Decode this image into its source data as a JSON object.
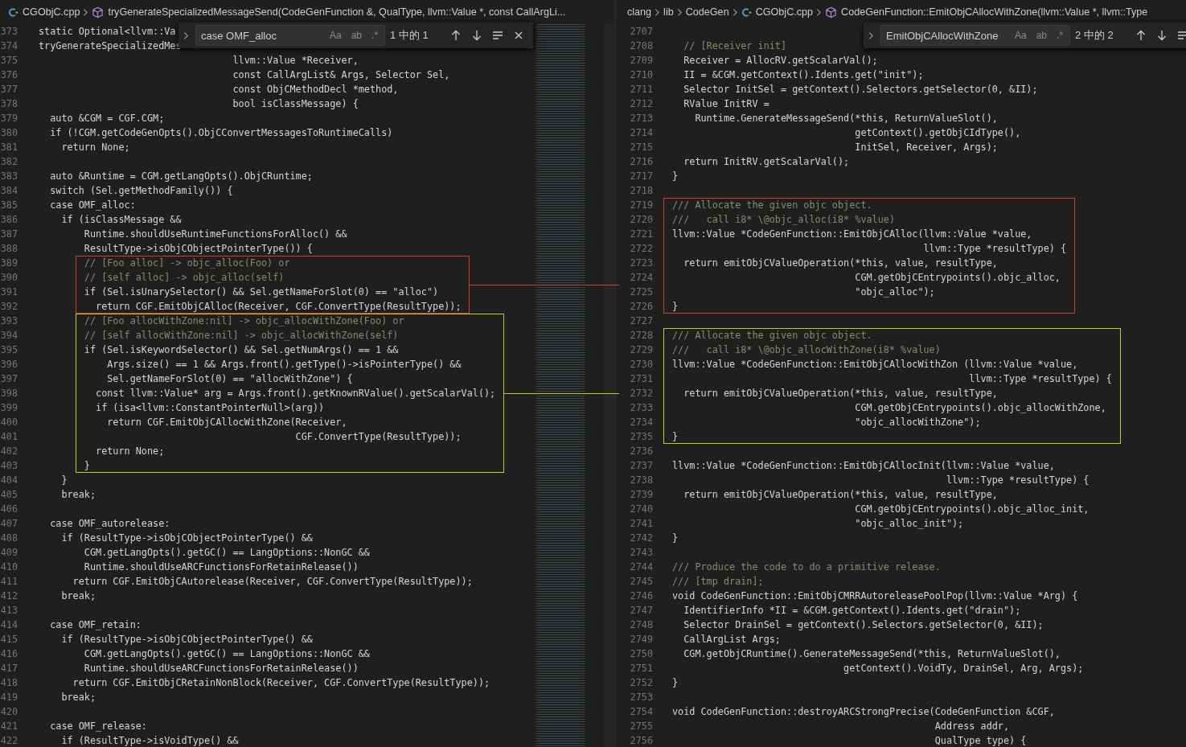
{
  "panes": [
    {
      "minimap": true,
      "breadcrumbs": [
        {
          "kind": "file",
          "text": "CGObjC.cpp"
        },
        {
          "kind": "symbol",
          "text": "tryGenerateSpecializedMessageSend(CodeGenFunction &, QualType, llvm::Value *, const CallArgLi..."
        }
      ],
      "find": {
        "value": "case OMF_alloc",
        "toggles": [
          "Aa",
          "ab",
          ".*"
        ],
        "count": "1 中的 1",
        "buttons": [
          {
            "kind": "previous"
          },
          {
            "kind": "next"
          },
          {
            "kind": "selection"
          },
          {
            "kind": "close"
          }
        ]
      },
      "blocks": [
        {
          "lines": [
            {
              "kind": "code",
              "number": "373",
              "code": "static Optional<llvm::Va"
            },
            {
              "kind": "code",
              "number": "374",
              "code": "tryGenerateSpecializedMes"
            },
            {
              "kind": "code",
              "number": "375",
              "code": "                                  llvm::Value *Receiver,"
            },
            {
              "kind": "code",
              "number": "376",
              "code": "                                  const CallArgList& Args, Selector Sel,"
            },
            {
              "kind": "code",
              "number": "377",
              "code": "                                  const ObjCMethodDecl *method,"
            },
            {
              "kind": "code",
              "number": "378",
              "code": "                                  bool isClassMessage) {"
            },
            {
              "kind": "code",
              "number": "379",
              "code": "  auto &CGM = CGF.CGM;"
            },
            {
              "kind": "code",
              "number": "380",
              "code": "  if (!CGM.getCodeGenOpts().ObjCConvertMessagesToRuntimeCalls)"
            },
            {
              "kind": "code",
              "number": "381",
              "code": "    return None;"
            },
            {
              "kind": "code",
              "number": "382"
            },
            {
              "kind": "code",
              "number": "383",
              "code": "  auto &Runtime = CGM.getLangOpts().ObjCRuntime;"
            },
            {
              "kind": "code",
              "number": "384",
              "code": "  switch (Sel.getMethodFamily()) {"
            },
            {
              "kind": "code",
              "number": "385",
              "code": "  case OMF_alloc:"
            },
            {
              "kind": "code",
              "number": "386",
              "code": "    if (isClassMessage &&"
            },
            {
              "kind": "code",
              "number": "387",
              "code": "        Runtime.shouldUseRuntimeFunctionsForAlloc() &&"
            },
            {
              "kind": "code",
              "number": "388",
              "code": "        ResultType->isObjCObjectPointerType()) {"
            }
          ]
        },
        {
          "color": "#c8402f",
          "lines": [
            {
              "kind": "comment",
              "number": "389",
              "code": "        // [Foo alloc] -> objc_alloc(Foo) or"
            },
            {
              "kind": "comment",
              "number": "390",
              "code": "        // [self alloc] -> objc_alloc(self)"
            },
            {
              "kind": "code",
              "number": "391",
              "code": "        if (Sel.isUnarySelector() && Sel.getNameForSlot(0) == \"alloc\")"
            },
            {
              "kind": "code",
              "number": "392",
              "code": "          return CGF.EmitObjCAlloc(Receiver, CGF.ConvertType(ResultType));"
            }
          ]
        },
        {
          "color": "#c9c53a",
          "lines": [
            {
              "kind": "comment",
              "number": "393",
              "code": "        // [Foo allocWithZone:nil] -> objc_allocWithZone(Foo) or"
            },
            {
              "kind": "comment",
              "number": "394",
              "code": "        // [self allocWithZone:nil] -> objc_allocWithZone(self)"
            },
            {
              "kind": "code",
              "number": "395",
              "code": "        if (Sel.isKeywordSelector() && Sel.getNumArgs() == 1 &&"
            },
            {
              "kind": "code",
              "number": "396",
              "code": "            Args.size() == 1 && Args.front().getType()->isPointerType() &&"
            },
            {
              "kind": "code",
              "number": "397",
              "code": "            Sel.getNameForSlot(0) == \"allocWithZone\") {"
            },
            {
              "kind": "code",
              "number": "398",
              "code": "          const llvm::Value* arg = Args.front().getKnownRValue().getScalarVal();"
            },
            {
              "kind": "code",
              "number": "399",
              "code": "          if (isa<llvm::ConstantPointerNull>(arg))"
            },
            {
              "kind": "code",
              "number": "400",
              "code": "            return CGF.EmitObjCAllocWithZone(Receiver,"
            },
            {
              "kind": "code",
              "number": "401",
              "code": "                                             CGF.ConvertType(ResultType));"
            },
            {
              "kind": "code",
              "number": "402",
              "code": "          return None;"
            },
            {
              "kind": "code",
              "number": "403",
              "code": "        }"
            }
          ]
        },
        {
          "lines": [
            {
              "kind": "code",
              "number": "404",
              "code": "    }"
            },
            {
              "kind": "code",
              "number": "405",
              "code": "    break;"
            },
            {
              "kind": "code",
              "number": "406"
            },
            {
              "kind": "code",
              "number": "407",
              "code": "  case OMF_autorelease:"
            },
            {
              "kind": "code",
              "number": "408",
              "code": "    if (ResultType->isObjCObjectPointerType() &&"
            },
            {
              "kind": "code",
              "number": "409",
              "code": "        CGM.getLangOpts().getGC() == LangOptions::NonGC &&"
            },
            {
              "kind": "code",
              "number": "410",
              "code": "        Runtime.shouldUseARCFunctionsForRetainRelease())"
            },
            {
              "kind": "code",
              "number": "411",
              "code": "      return CGF.EmitObjCAutorelease(Receiver, CGF.ConvertType(ResultType));"
            },
            {
              "kind": "code",
              "number": "412",
              "code": "    break;"
            },
            {
              "kind": "code",
              "number": "413"
            },
            {
              "kind": "code",
              "number": "414",
              "code": "  case OMF_retain:"
            },
            {
              "kind": "code",
              "number": "415",
              "code": "    if (ResultType->isObjCObjectPointerType() &&"
            },
            {
              "kind": "code",
              "number": "416",
              "code": "        CGM.getLangOpts().getGC() == LangOptions::NonGC &&"
            },
            {
              "kind": "code",
              "number": "417",
              "code": "        Runtime.shouldUseARCFunctionsForRetainRelease())"
            },
            {
              "kind": "code",
              "number": "418",
              "code": "      return CGF.EmitObjCRetainNonBlock(Receiver, CGF.ConvertType(ResultType));"
            },
            {
              "kind": "code",
              "number": "419",
              "code": "    break;"
            },
            {
              "kind": "code",
              "number": "420"
            },
            {
              "kind": "code",
              "number": "421",
              "code": "  case OMF_release:"
            },
            {
              "kind": "code",
              "number": "422",
              "code": "    if (ResultType->isVoidType() &&"
            }
          ]
        }
      ]
    },
    {
      "minimap": false,
      "breadcrumbs": [
        {
          "kind": "folder",
          "text": "clang"
        },
        {
          "kind": "folder",
          "text": "lib"
        },
        {
          "kind": "folder",
          "text": "CodeGen"
        },
        {
          "kind": "file",
          "text": "CGObjC.cpp"
        },
        {
          "kind": "symbol",
          "text": "CodeGenFunction::EmitObjCAllocWithZone(llvm::Value *, llvm::Type"
        }
      ],
      "find": {
        "value": "EmitObjCAllocWithZone",
        "toggles": [
          "Aa",
          "ab",
          ".*"
        ],
        "count": "2 中的 2",
        "buttons": [
          {
            "kind": "previous"
          },
          {
            "kind": "next"
          },
          {
            "kind": "selection"
          }
        ]
      },
      "blocks": [
        {
          "lines": [
            {
              "kind": "code",
              "number": "2707"
            },
            {
              "kind": "comment",
              "number": "2708",
              "code": "  // [Receiver init]"
            },
            {
              "kind": "code",
              "number": "2709",
              "code": "  Receiver = AllocRV.getScalarVal();"
            },
            {
              "kind": "code",
              "number": "2710",
              "code": "  II = &CGM.getContext().Idents.get(\"init\");"
            },
            {
              "kind": "code",
              "number": "2711",
              "code": "  Selector InitSel = getContext().Selectors.getSelector(0, &II);"
            },
            {
              "kind": "code",
              "number": "2712",
              "code": "  RValue InitRV ="
            },
            {
              "kind": "code",
              "number": "2713",
              "code": "    Runtime.GenerateMessageSend(*this, ReturnValueSlot(),"
            },
            {
              "kind": "code",
              "number": "2714",
              "code": "                                getContext().getObjCIdType(),"
            },
            {
              "kind": "code",
              "number": "2715",
              "code": "                                InitSel, Receiver, Args);"
            },
            {
              "kind": "code",
              "number": "2716",
              "code": "  return InitRV.getScalarVal();"
            },
            {
              "kind": "code",
              "number": "2717",
              "code": "}"
            },
            {
              "kind": "code",
              "number": "2718"
            }
          ]
        },
        {
          "color": "#c8402f",
          "lines": [
            {
              "kind": "comment",
              "number": "2719",
              "code": "/// Allocate the given objc object."
            },
            {
              "kind": "comment",
              "number": "2720",
              "code": "///   call i8* \\@objc_alloc(i8* %value)"
            },
            {
              "kind": "code",
              "number": "2721",
              "code": "llvm::Value *CodeGenFunction::EmitObjCAlloc(llvm::Value *value,"
            },
            {
              "kind": "code",
              "number": "2722",
              "code": "                                            llvm::Type *resultType) {"
            },
            {
              "kind": "code",
              "number": "2723",
              "code": "  return emitObjCValueOperation(*this, value, resultType,"
            },
            {
              "kind": "code",
              "number": "2724",
              "code": "                                CGM.getObjCEntrypoints().objc_alloc,"
            },
            {
              "kind": "code",
              "number": "2725",
              "code": "                                \"objc_alloc\");"
            },
            {
              "kind": "code",
              "number": "2726",
              "code": "}"
            }
          ]
        },
        {
          "lines": [
            {
              "kind": "code",
              "number": "2727"
            }
          ]
        },
        {
          "color": "#c9c53a",
          "lines": [
            {
              "kind": "comment",
              "number": "2728",
              "code": "/// Allocate the given objc object."
            },
            {
              "kind": "comment",
              "number": "2729",
              "code": "///   call i8* \\@objc_allocWithZone(i8* %value)"
            },
            {
              "kind": "code",
              "number": "2730",
              "code": "llvm::Value *CodeGenFunction::EmitObjCAllocWithZon (llvm::Value *value,"
            },
            {
              "kind": "code",
              "number": "2731",
              "code": "                                                    llvm::Type *resultType) {"
            },
            {
              "kind": "code",
              "number": "2732",
              "code": "  return emitObjCValueOperation(*this, value, resultType,"
            },
            {
              "kind": "code",
              "number": "2733",
              "code": "                                CGM.getObjCEntrypoints().objc_allocWithZone,"
            },
            {
              "kind": "code",
              "number": "2734",
              "code": "                                \"objc_allocWithZone\");"
            },
            {
              "kind": "code",
              "number": "2735",
              "code": "}"
            }
          ]
        },
        {
          "lines": [
            {
              "kind": "code",
              "number": "2736"
            },
            {
              "kind": "code",
              "number": "2737",
              "code": "llvm::Value *CodeGenFunction::EmitObjCAllocInit(llvm::Value *value,"
            },
            {
              "kind": "code",
              "number": "2738",
              "code": "                                                llvm::Type *resultType) {"
            },
            {
              "kind": "code",
              "number": "2739",
              "code": "  return emitObjCValueOperation(*this, value, resultType,"
            },
            {
              "kind": "code",
              "number": "2740",
              "code": "                                CGM.getObjCEntrypoints().objc_alloc_init,"
            },
            {
              "kind": "code",
              "number": "2741",
              "code": "                                \"objc_alloc_init\");"
            },
            {
              "kind": "code",
              "number": "2742",
              "code": "}"
            },
            {
              "kind": "code",
              "number": "2743"
            },
            {
              "kind": "comment",
              "number": "2744",
              "code": "/// Produce the code to do a primitive release."
            },
            {
              "kind": "comment",
              "number": "2745",
              "code": "/// [tmp drain];"
            },
            {
              "kind": "code",
              "number": "2746",
              "code": "void CodeGenFunction::EmitObjCMRRAutoreleasePoolPop(llvm::Value *Arg) {"
            },
            {
              "kind": "code",
              "number": "2747",
              "code": "  IdentifierInfo *II = &CGM.getContext().Idents.get(\"drain\");"
            },
            {
              "kind": "code",
              "number": "2748",
              "code": "  Selector DrainSel = getContext().Selectors.getSelector(0, &II);"
            },
            {
              "kind": "code",
              "number": "2749",
              "code": "  CallArgList Args;"
            },
            {
              "kind": "code",
              "number": "2750",
              "code": "  CGM.getObjCRuntime().GenerateMessageSend(*this, ReturnValueSlot(),"
            },
            {
              "kind": "code",
              "number": "2751",
              "code": "                              getContext().VoidTy, DrainSel, Arg, Args);"
            },
            {
              "kind": "code",
              "number": "2752",
              "code": "}"
            },
            {
              "kind": "code",
              "number": "2753"
            },
            {
              "kind": "code",
              "number": "2754",
              "code": "void CodeGenFunction::destroyARCStrongPrecise(CodeGenFunction &CGF,"
            },
            {
              "kind": "code",
              "number": "2755",
              "code": "                                              Address addr,"
            },
            {
              "kind": "code",
              "number": "2756",
              "code": "                                              QualType type) {"
            }
          ]
        }
      ]
    }
  ]
}
